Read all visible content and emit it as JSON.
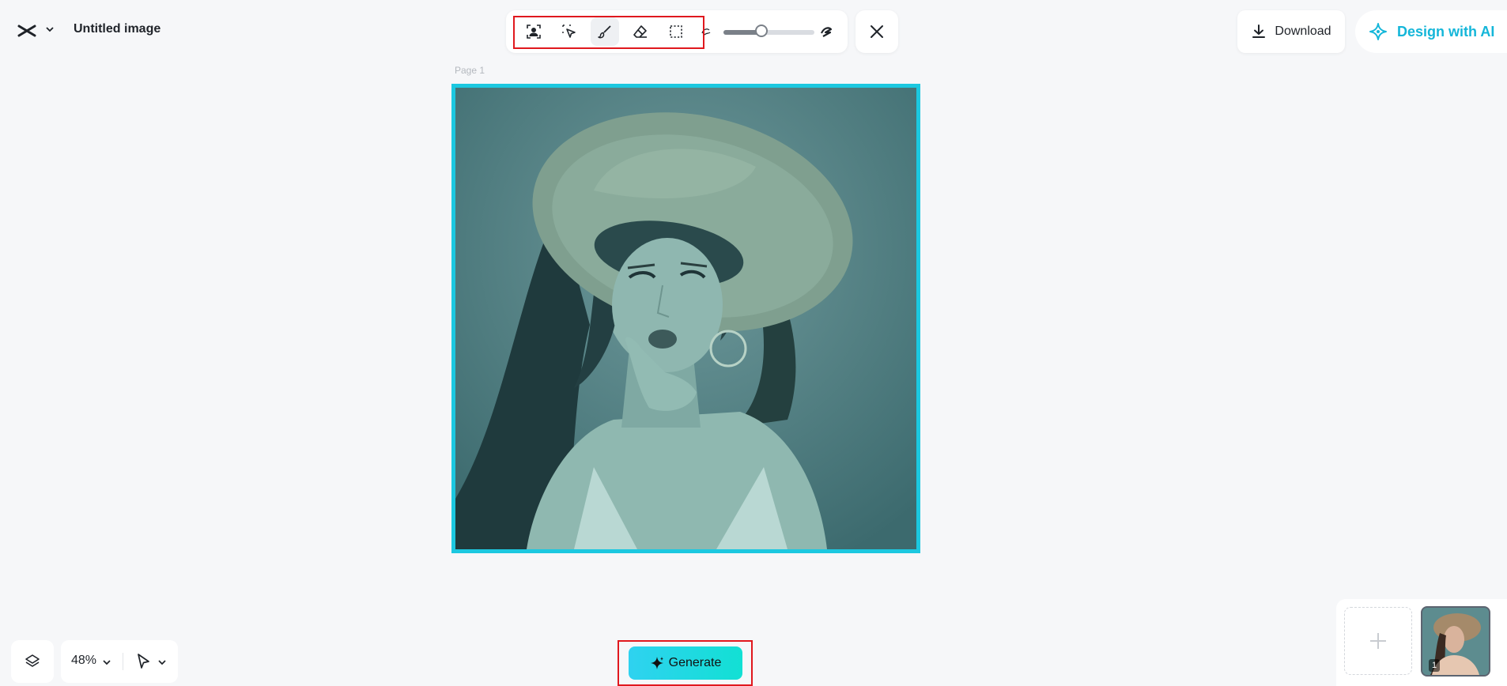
{
  "header": {
    "title": "Untitled image",
    "logo_icon": "capcut-logo-icon",
    "download_label": "Download",
    "design_ai_label": "Design with AI"
  },
  "toolbar": {
    "tools": [
      {
        "name": "auto-select-subject",
        "icon": "person-select-icon"
      },
      {
        "name": "quick-select",
        "icon": "cursor-select-icon"
      },
      {
        "name": "brush",
        "icon": "brush-icon",
        "active": true
      },
      {
        "name": "eraser",
        "icon": "eraser-icon"
      },
      {
        "name": "rectangle-select",
        "icon": "marquee-icon"
      }
    ],
    "brush_size_fraction": 0.42
  },
  "canvas": {
    "page_label": "Page 1",
    "frame_color": "#1cc8e0"
  },
  "bottom": {
    "zoom_label": "48%",
    "generate_label": "Generate"
  },
  "pages": {
    "thumb_number": "1"
  },
  "colors": {
    "accent": "#14b6d9",
    "highlight": "#e0181e",
    "generate_gradient_start": "#2fd2f0",
    "generate_gradient_end": "#12e0d4"
  }
}
